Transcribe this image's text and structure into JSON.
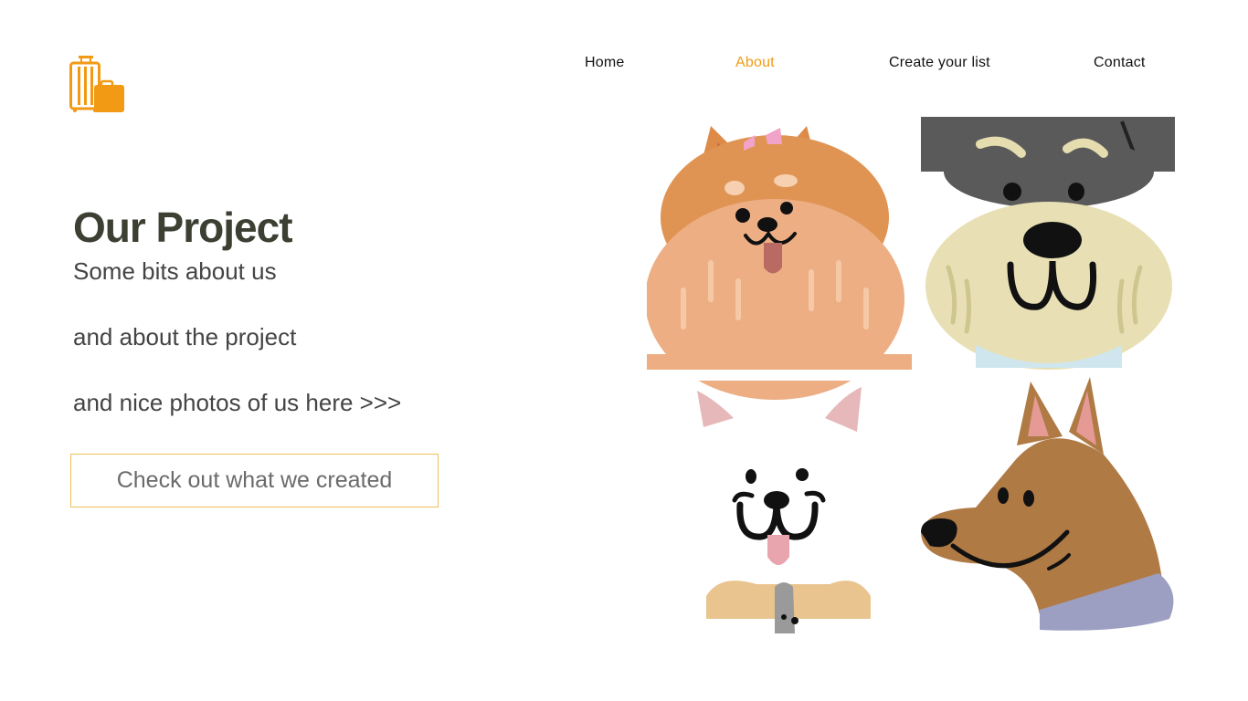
{
  "nav": {
    "items": [
      {
        "label": "Home"
      },
      {
        "label": "About",
        "active": true
      },
      {
        "label": "Create your list"
      },
      {
        "label": "Contact"
      }
    ]
  },
  "hero": {
    "title": "Our Project",
    "lines": [
      "Some bits about us",
      "and about the project",
      "and nice photos of us here >>>"
    ],
    "cta_label": "Check out what we created"
  },
  "colors": {
    "accent": "#f29a14",
    "cta_border": "#eec05a",
    "title": "#3b4033"
  },
  "icons": {
    "logo": "luggage-icon"
  }
}
